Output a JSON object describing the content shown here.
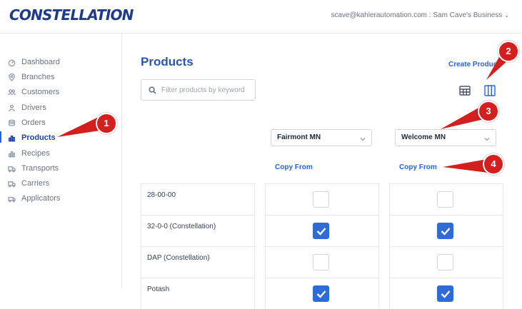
{
  "header": {
    "logo": "CONSTELLATION",
    "account": "scave@kahlerautomation.com : Sam Cave's Business",
    "account_chevron": "chevron-down-icon"
  },
  "sidebar": {
    "items": [
      {
        "label": "Dashboard",
        "icon": "dashboard-icon",
        "active": false
      },
      {
        "label": "Branches",
        "icon": "location-pin-icon",
        "active": false
      },
      {
        "label": "Customers",
        "icon": "users-icon",
        "active": false
      },
      {
        "label": "Drivers",
        "icon": "driver-icon",
        "active": false
      },
      {
        "label": "Orders",
        "icon": "orders-icon",
        "active": false
      },
      {
        "label": "Products",
        "icon": "products-icon",
        "active": true
      },
      {
        "label": "Recipes",
        "icon": "recipes-icon",
        "active": false
      },
      {
        "label": "Transports",
        "icon": "truck-icon",
        "active": false
      },
      {
        "label": "Carriers",
        "icon": "truck-icon",
        "active": false
      },
      {
        "label": "Applicators",
        "icon": "applicator-icon",
        "active": false
      }
    ]
  },
  "main": {
    "title": "Products",
    "create_label": "Create Product",
    "search": {
      "placeholder": "Filter products by keyword",
      "value": ""
    },
    "view_icons": [
      "table-view-icon",
      "column-view-icon"
    ],
    "branches": [
      {
        "name": "Fairmont MN",
        "copy_label": "Copy From"
      },
      {
        "name": "Welcome MN",
        "copy_label": "Copy From"
      }
    ],
    "products": [
      {
        "name": "28-00-00",
        "checked": [
          false,
          false
        ]
      },
      {
        "name": "32-0-0 (Constellation)",
        "checked": [
          true,
          true
        ]
      },
      {
        "name": "DAP (Constellation)",
        "checked": [
          false,
          false
        ]
      },
      {
        "name": "Potash",
        "checked": [
          true,
          true
        ]
      }
    ]
  },
  "annotations": [
    "1",
    "2",
    "3",
    "4"
  ],
  "colors": {
    "brand": "#1e3a8a",
    "accent": "#2563eb",
    "checkbox_checked": "#2f6bd4",
    "annotation_marker": "#d41f1f"
  }
}
